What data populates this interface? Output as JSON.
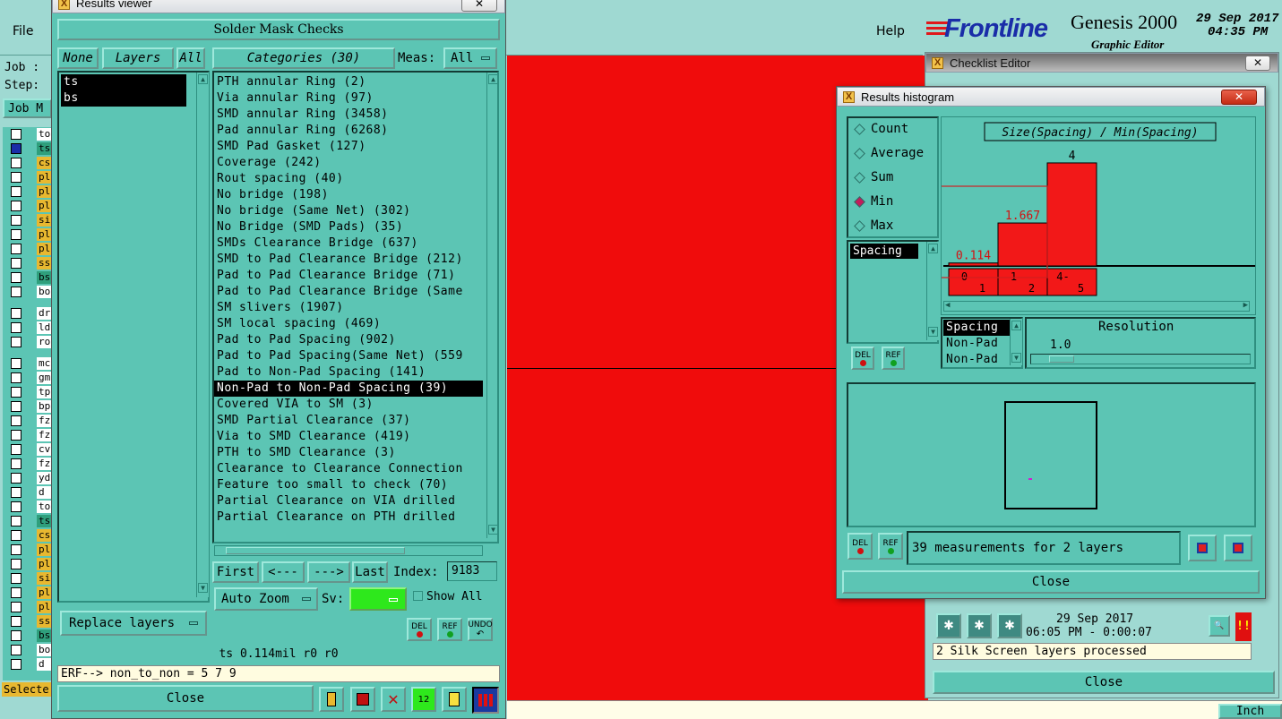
{
  "main": {
    "menu_file": "File",
    "menu_help": "Help",
    "job_label": "Job :",
    "step_label": "Step:",
    "job_button": "Job M",
    "selected_label": "Selecte",
    "brand": "Frontline",
    "product": "Genesis 2000",
    "product_sub": "Graphic Editor",
    "date": "29 Sep 2017",
    "time": "04:35 PM",
    "unit_button": "Inch",
    "layer_rows": [
      "to",
      "ts",
      "cs",
      "pl",
      "pl",
      "pl",
      "si",
      "pl",
      "pl",
      "ss",
      "bs",
      "bo",
      "dr",
      "ld",
      "ro",
      "mc",
      "gm",
      "tp",
      "bp",
      "fz",
      "fz",
      "cv",
      "fz",
      "yd",
      "d",
      "to",
      "ts",
      "cs",
      "pl",
      "pl",
      "si",
      "pl",
      "pl",
      "ss",
      "bs",
      "bo",
      "d"
    ],
    "canvas_color": "#f00c0c"
  },
  "results_viewer": {
    "title": "Results viewer",
    "header": "Solder Mask Checks",
    "none_btn": "None",
    "layers_btn": "Layers",
    "all_btn": "All",
    "categories_btn": "Categories (30)",
    "meas_label": "Meas:",
    "meas_value": "All",
    "layers": [
      "ts",
      "bs"
    ],
    "categories": [
      "PTH annular Ring (2)",
      "Via annular Ring (97)",
      "SMD annular Ring (3458)",
      "Pad annular Ring (6268)",
      "SMD Pad Gasket (127)",
      "Coverage (242)",
      "Rout spacing (40)",
      "No bridge (198)",
      "No bridge (Same Net) (302)",
      "No Bridge (SMD Pads) (35)",
      "SMDs Clearance Bridge (637)",
      "SMD to Pad Clearance Bridge (212)",
      "Pad to Pad Clearance Bridge (71)",
      "Pad to Pad Clearance Bridge (Same",
      "SM slivers (1907)",
      "SM local spacing (469)",
      "Pad to Pad Spacing (902)",
      "Pad to Pad Spacing(Same Net) (559",
      "Pad to Non-Pad Spacing (141)",
      "Non-Pad to Non-Pad Spacing (39)",
      "Covered VIA to SM (3)",
      "SMD Partial Clearance (37)",
      "Via to SMD Clearance (419)",
      "PTH to SMD Clearance (3)",
      "Clearance to Clearance Connection",
      "Feature too small to check (70)",
      "Partial Clearance on VIA drilled",
      "Partial Clearance on PTH drilled"
    ],
    "selected_category_index": 19,
    "first_btn": "First",
    "prev_btn": "<---",
    "next_btn": "--->",
    "last_btn": "Last",
    "index_label": "Index:",
    "index_value": "9183",
    "auto_zoom": "Auto Zoom",
    "sv_label": "Sv:",
    "show_all": "Show All",
    "replace_layers": "Replace layers",
    "del_label": "DEL",
    "ref_label": "REF",
    "undo_label": "UNDO",
    "status": "ts 0.114mil  r0  r0",
    "erf": "ERF--> non_to_non = 5 7 9",
    "close": "Close"
  },
  "checklist_editor": {
    "title": "Checklist Editor",
    "date": "29 Sep 2017",
    "time": "06:05 PM - 0:00:07",
    "message": "2 Silk Screen layers processed",
    "close": "Close"
  },
  "histogram": {
    "title": "Results histogram",
    "modes": [
      {
        "label": "Count",
        "selected": false
      },
      {
        "label": "Average",
        "selected": false
      },
      {
        "label": "Sum",
        "selected": false
      },
      {
        "label": "Min",
        "selected": true
      },
      {
        "label": "Max",
        "selected": false
      }
    ],
    "measure_item": "Spacing",
    "del_label": "DEL",
    "ref_label": "REF",
    "list_items": [
      "Spacing",
      "Non-Pad",
      "Non-Pad"
    ],
    "resolution_label": "Resolution",
    "resolution_value": "1.0",
    "measurements": "39 measurements for 2 layers",
    "close": "Close"
  },
  "chart_data": {
    "type": "bar",
    "title": "Size(Spacing) / Min(Spacing)",
    "categories": [
      "0\n1",
      "1\n2",
      "4-\n5"
    ],
    "bins": [
      [
        "0",
        "1"
      ],
      [
        "1",
        "2"
      ],
      [
        "4-",
        "5"
      ]
    ],
    "values": [
      0.114,
      1.667,
      4
    ],
    "value_labels": [
      "0.114",
      "1.667",
      "4"
    ],
    "ylim": [
      0,
      4.6
    ],
    "bar_color": "#f21818"
  }
}
